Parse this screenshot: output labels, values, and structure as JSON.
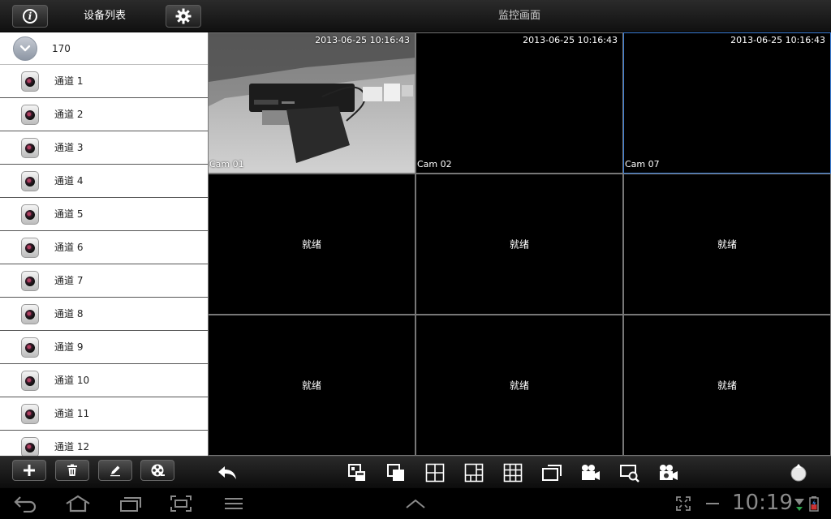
{
  "header": {
    "device_list_title": "设备列表",
    "monitor_title": "监控画面"
  },
  "sidebar": {
    "group": {
      "label": "170"
    },
    "channels": [
      {
        "label": "通道 1"
      },
      {
        "label": "通道 2"
      },
      {
        "label": "通道 3"
      },
      {
        "label": "通道 4"
      },
      {
        "label": "通道 5"
      },
      {
        "label": "通道 6"
      },
      {
        "label": "通道 7"
      },
      {
        "label": "通道 8"
      },
      {
        "label": "通道 9"
      },
      {
        "label": "通道 10"
      },
      {
        "label": "通道 11"
      },
      {
        "label": "通道 12"
      }
    ]
  },
  "grid": {
    "cells": [
      {
        "timestamp": "2013-06-25 10:16:43",
        "camera": "Cam 01",
        "status": "",
        "has_video": true,
        "selected": false
      },
      {
        "timestamp": "2013-06-25 10:16:43",
        "camera": "Cam 02",
        "status": "",
        "has_video": false,
        "selected": false
      },
      {
        "timestamp": "2013-06-25 10:16:43",
        "camera": "Cam 07",
        "status": "",
        "has_video": false,
        "selected": true
      },
      {
        "timestamp": "",
        "camera": "",
        "status": "就绪"
      },
      {
        "timestamp": "",
        "camera": "",
        "status": "就绪"
      },
      {
        "timestamp": "",
        "camera": "",
        "status": "就绪"
      },
      {
        "timestamp": "",
        "camera": "",
        "status": "就绪"
      },
      {
        "timestamp": "",
        "camera": "",
        "status": "就绪"
      },
      {
        "timestamp": "",
        "camera": "",
        "status": "就绪"
      }
    ]
  },
  "toolbar": {
    "left_buttons": [
      "add-icon",
      "trash-icon",
      "edit-pencil-icon",
      "film-reel-icon"
    ],
    "icons": [
      "back-arrow-icon",
      "layout-switch-icon",
      "window-overlap-icon",
      "grid-4-icon",
      "grid-6-icon",
      "grid-9-icon",
      "fullscreen-icon",
      "record-video-icon",
      "snapshot-search-icon",
      "playback-video-icon",
      "ptz-control-icon"
    ]
  },
  "system_bar": {
    "time": "10:19",
    "icons": [
      "nav-back-icon",
      "nav-home-icon",
      "nav-recent-apps-icon",
      "screenshot-icon",
      "menu-icon",
      "chevron-up-icon",
      "expand-icon",
      "minus-icon",
      "wifi-icon",
      "battery-icon"
    ]
  },
  "colors": {
    "selected_border": "#3d7fd6",
    "grid_line": "#777777",
    "sidebar_bg": "#ffffff"
  }
}
